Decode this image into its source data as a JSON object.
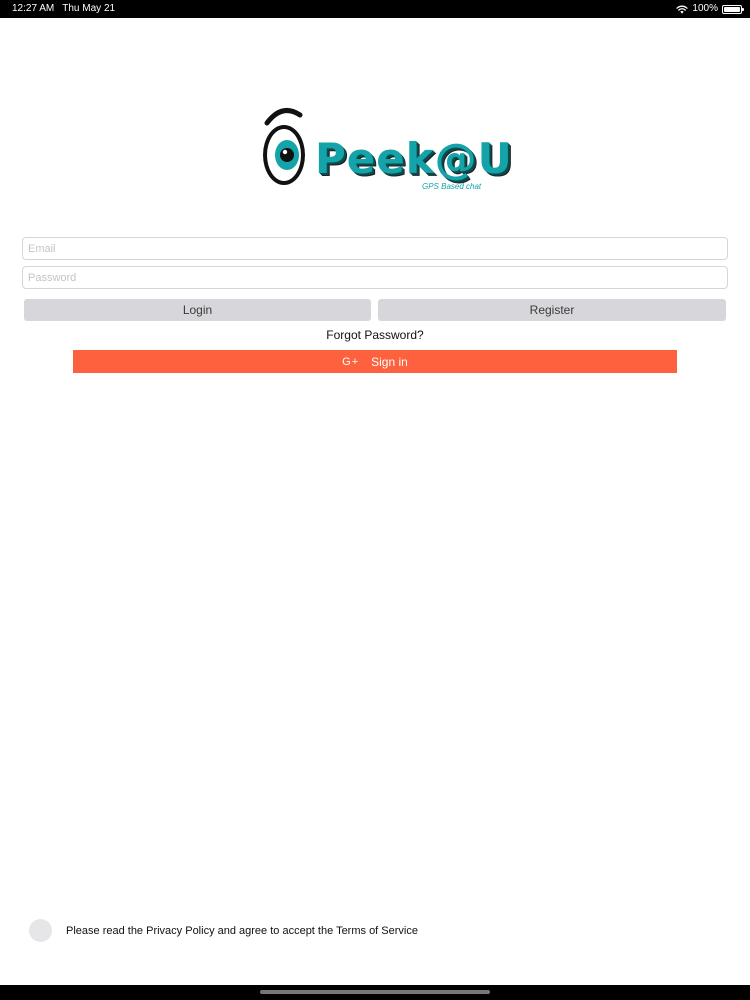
{
  "status_bar": {
    "time": "12:27 AM",
    "date": "Thu May 21",
    "battery": "100%",
    "wifi_icon": "wifi-icon",
    "battery_icon": "battery-icon"
  },
  "logo": {
    "name": "Peek@U",
    "tagline": "GPS Based chat"
  },
  "form": {
    "email_placeholder": "Email",
    "email_value": "",
    "password_placeholder": "Password",
    "password_value": "",
    "login_label": "Login",
    "register_label": "Register",
    "forgot_label": "Forgot Password?",
    "google_icon_label": "G+",
    "google_label": "Sign in"
  },
  "consent": {
    "text": "Please read the Privacy Policy and agree to accept the Terms of Service"
  },
  "colors": {
    "accent_orange": "#fd613d",
    "brand_teal": "#14a3a8",
    "button_gray": "#d7d7db"
  }
}
